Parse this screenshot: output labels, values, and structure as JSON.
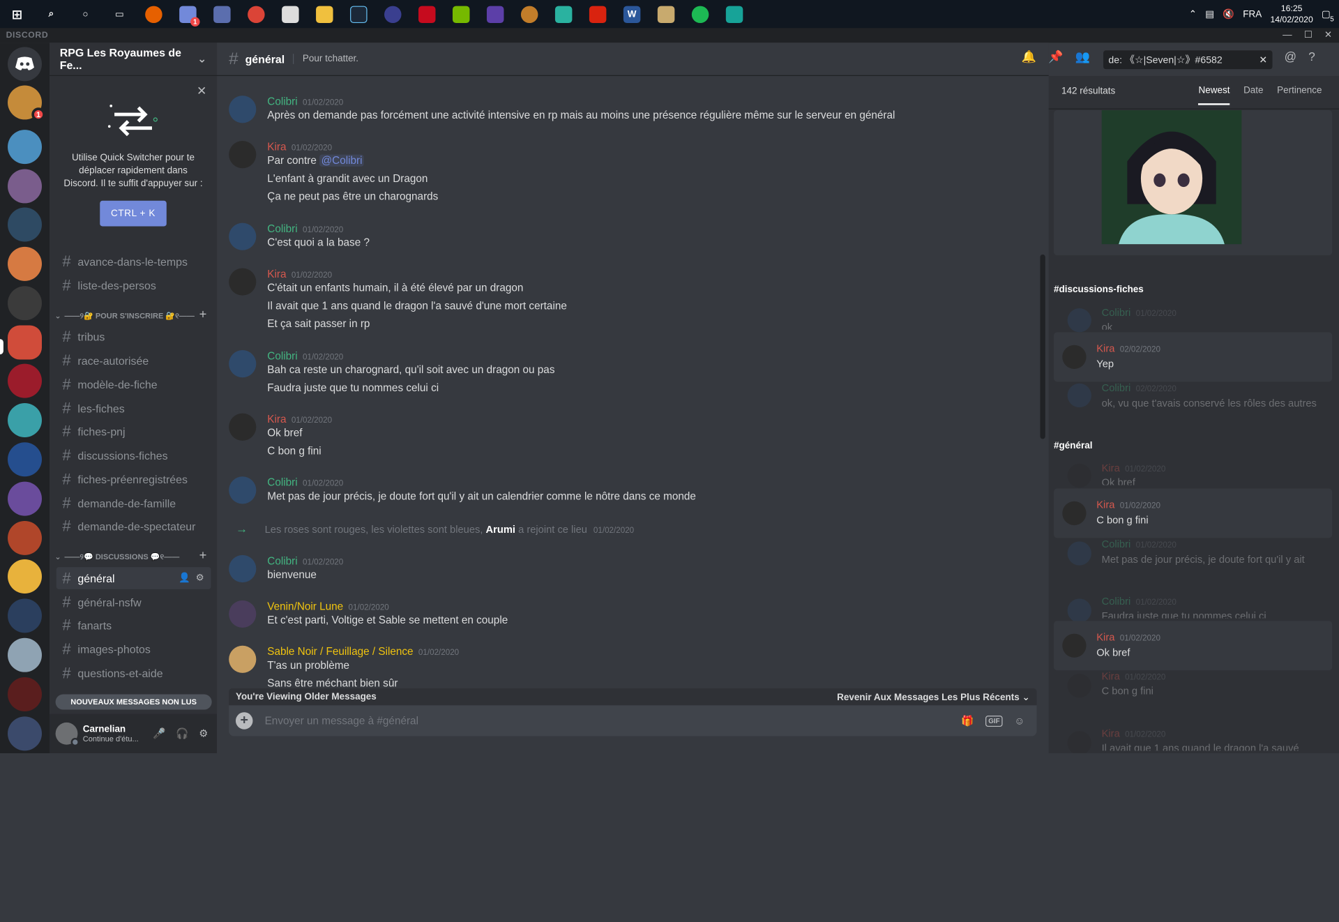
{
  "taskbar": {
    "lang": "FRA",
    "time": "16:25",
    "date": "14/02/2020",
    "notif_count": "5",
    "app_badge": "1"
  },
  "app": {
    "brand": "DISCORD"
  },
  "servers": {
    "home_badge": "1"
  },
  "guild": {
    "name": "RPG Les Royaumes de Fe..."
  },
  "quick_switcher": {
    "text": "Utilise Quick Switcher pour te déplacer rapidement dans Discord. Il te suffit d'appuyer sur :",
    "button": "CTRL + K"
  },
  "channels": {
    "top": [
      "avance-dans-le-temps",
      "liste-des-persos"
    ],
    "cat1": "——୨🔐 POUR S'INSCRIRE 🔐୧——",
    "inscription": [
      "tribus",
      "race-autorisée",
      "modèle-de-fiche",
      "les-fiches",
      "fiches-pnj",
      "discussions-fiches",
      "fiches-préenregistrées",
      "demande-de-famille",
      "demande-de-spectateur"
    ],
    "cat2": "——୨💬 DISCUSSIONS 💬୧——",
    "discussions": [
      "général",
      "général-nsfw",
      "fanarts",
      "images-photos",
      "questions-et-aide"
    ],
    "new_messages": "NOUVEAUX MESSAGES NON LUS"
  },
  "user": {
    "name": "Carnelian",
    "status": "Continue d'étu..."
  },
  "chat": {
    "channel": "général",
    "topic": "Pour tchatter.",
    "messages": [
      {
        "author": "Colibri",
        "color": "#43b581",
        "ts": "01/02/2020",
        "lines": [
          "Après on demande pas forcément une activité intensive en rp mais au moins une présence régulière même sur le serveur en général"
        ]
      },
      {
        "author": "Kira",
        "color": "#d6584e",
        "ts": "01/02/2020",
        "lines": [
          "Par contre",
          "L'enfant à grandit avec un Dragon",
          "Ça ne peut pas être un charognards"
        ],
        "mention": "@Colibri"
      },
      {
        "author": "Colibri",
        "color": "#43b581",
        "ts": "01/02/2020",
        "lines": [
          "C'est quoi a la base ?"
        ]
      },
      {
        "author": "Kira",
        "color": "#d6584e",
        "ts": "01/02/2020",
        "lines": [
          "C'était un enfants humain, il à été élevé par un dragon",
          "Il avait que 1 ans quand le dragon l'a sauvé d'une mort certaine",
          "Et ça sait passer in rp"
        ]
      },
      {
        "author": "Colibri",
        "color": "#43b581",
        "ts": "01/02/2020",
        "lines": [
          "Bah ca reste un charognard, qu'il soit avec un dragon ou pas",
          "Faudra juste que tu nommes celui ci"
        ]
      },
      {
        "author": "Kira",
        "color": "#d6584e",
        "ts": "01/02/2020",
        "lines": [
          "Ok bref",
          "C bon g fini"
        ]
      },
      {
        "author": "Colibri",
        "color": "#43b581",
        "ts": "01/02/2020",
        "lines": [
          "Met pas de jour précis, je doute fort qu'il y ait un calendrier comme le nôtre dans ce monde"
        ]
      },
      {
        "author": "Colibri",
        "color": "#43b581",
        "ts": "01/02/2020",
        "lines": [
          "bienvenue"
        ]
      },
      {
        "author": "Venin/Noir Lune",
        "color": "#f1c40f",
        "ts": "01/02/2020",
        "lines": [
          "Et c'est parti, Voltige et Sable se mettent en couple"
        ]
      },
      {
        "author": "Sable Noir / Feuillage / Silence",
        "color": "#f1c40f",
        "ts": "01/02/2020",
        "lines": [
          "T'as un problème",
          "Sans être méchant bien sûr"
        ]
      }
    ],
    "system": {
      "pre": "Les roses sont rouges, les violettes sont bleues,",
      "who": "Arumi",
      "post": "a rejoint ce lieu",
      "ts": "01/02/2020"
    },
    "older_notice": "You're Viewing Older Messages",
    "jump_present": "Revenir Aux Messages Les Plus Récents",
    "placeholder": "Envoyer un message à #général",
    "gif": "GIF"
  },
  "search": {
    "query": "de: 《☆|Seven|☆》#6582",
    "count": "142 résultats",
    "tabs": [
      "Newest",
      "Date",
      "Pertinence"
    ],
    "group1": "#discussions-fiches",
    "group2": "#général",
    "g1": [
      {
        "author": "Colibri",
        "color": "#43b581",
        "ts": "01/02/2020",
        "text": "ok",
        "ctx": true
      },
      {
        "author": "Kira",
        "color": "#d6584e",
        "ts": "02/02/2020",
        "text": "Yep",
        "ctx": false
      },
      {
        "author": "Colibri",
        "color": "#43b581",
        "ts": "02/02/2020",
        "text": "ok, vu que t'avais conservé les rôles des autres",
        "ctx": true
      }
    ],
    "g2": [
      {
        "author": "Kira",
        "color": "#d6584e",
        "ts": "01/02/2020",
        "text": "Ok bref",
        "ctx": true
      },
      {
        "author": "Kira",
        "color": "#d6584e",
        "ts": "01/02/2020",
        "text": "C bon g fini",
        "ctx": false
      },
      {
        "author": "Colibri",
        "color": "#43b581",
        "ts": "01/02/2020",
        "text": "Met pas de jour précis, je doute fort qu'il y ait",
        "ctx": true
      },
      {
        "author": "Colibri",
        "color": "#43b581",
        "ts": "01/02/2020",
        "text": "Faudra juste que tu nommes celui ci",
        "ctx": true
      },
      {
        "author": "Kira",
        "color": "#d6584e",
        "ts": "01/02/2020",
        "text": "Ok bref",
        "ctx": false
      },
      {
        "author": "Kira",
        "color": "#d6584e",
        "ts": "01/02/2020",
        "text": "C bon g fini",
        "ctx": true
      },
      {
        "author": "Kira",
        "color": "#d6584e",
        "ts": "01/02/2020",
        "text": "Il avait que 1 ans quand le dragon l'a sauvé",
        "ctx": true
      }
    ]
  }
}
